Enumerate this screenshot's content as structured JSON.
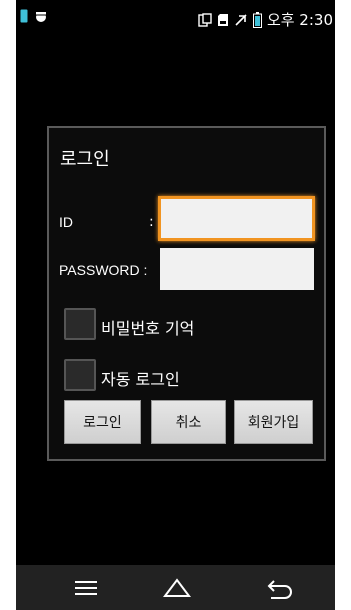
{
  "status_bar": {
    "time": "오후 2:30",
    "icons_left": [
      "sim-icon",
      "android-debug-icon"
    ],
    "icons_right": [
      "screenshot-icon",
      "sd-card-icon",
      "airplane-mode-icon",
      "battery-icon"
    ]
  },
  "dialog": {
    "title": "로그인",
    "id_label": "ID",
    "id_colon": ":",
    "id_value": "",
    "password_label": "PASSWORD :",
    "password_value": "",
    "remember_password_label": "비밀번호 기억",
    "auto_login_label": "자동 로그인",
    "buttons": {
      "login": "로그인",
      "cancel": "취소",
      "signup": "회원가입"
    }
  },
  "nav_bar": {
    "icons": [
      "menu-icon",
      "home-icon",
      "back-icon"
    ]
  },
  "colors": {
    "background": "#000000",
    "focus_accent": "#f19421",
    "dialog_border": "#5a5a5a"
  }
}
